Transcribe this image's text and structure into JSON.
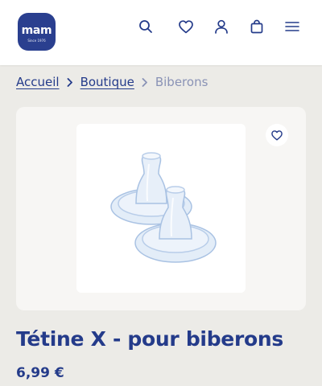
{
  "header": {
    "logo": {
      "wordmark": "mam",
      "tagline": "Since 1976"
    },
    "icons": [
      "search-icon",
      "heart-icon",
      "user-icon",
      "bag-icon",
      "menu-icon"
    ]
  },
  "breadcrumb": {
    "items": [
      {
        "label": "Accueil",
        "link": true
      },
      {
        "label": "Boutique",
        "link": true
      },
      {
        "label": "Biberons",
        "link": false
      }
    ]
  },
  "product": {
    "title": "Tétine X - pour biberons",
    "price": "6,99 €"
  },
  "colors": {
    "brand": "#2a3f8f",
    "text": "#243b8a",
    "page_bg": "#ecebe7",
    "card_bg": "#f7f6f4",
    "breadcrumb_current": "#8a93b6"
  }
}
